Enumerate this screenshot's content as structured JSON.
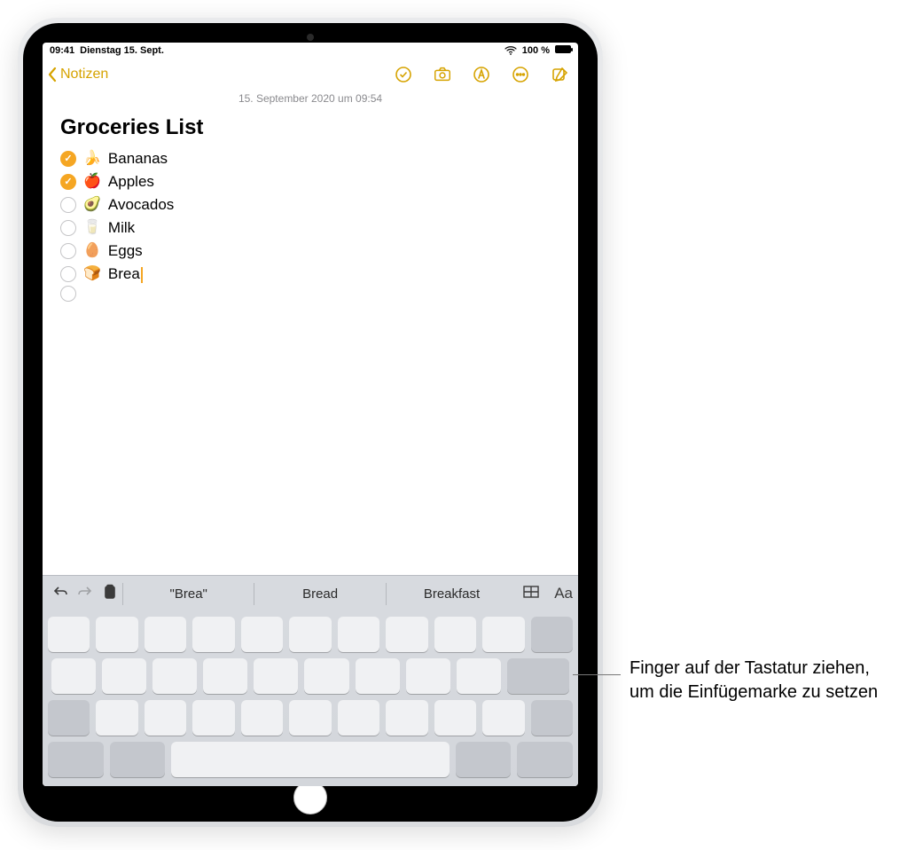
{
  "statusbar": {
    "time": "09:41",
    "date": "Dienstag 15. Sept.",
    "battery_pct": "100 %"
  },
  "navbar": {
    "back_label": "Notizen"
  },
  "note": {
    "date_header": "15. September 2020 um 09:54",
    "title": "Groceries List",
    "items": [
      {
        "checked": true,
        "emoji": "🍌",
        "text": "Bananas"
      },
      {
        "checked": true,
        "emoji": "🍎",
        "text": "Apples"
      },
      {
        "checked": false,
        "emoji": "🥑",
        "text": "Avocados"
      },
      {
        "checked": false,
        "emoji": "🥛",
        "text": "Milk"
      },
      {
        "checked": false,
        "emoji": "🥚",
        "text": "Eggs"
      },
      {
        "checked": false,
        "emoji": "🍞",
        "text": "Brea",
        "caret": true
      },
      {
        "checked": false,
        "emoji": "",
        "text": ""
      }
    ]
  },
  "suggestions": {
    "s1": "\"Brea\"",
    "s2": "Bread",
    "s3": "Breakfast",
    "aa": "Aa"
  },
  "callout": {
    "text": "Finger auf der Tastatur ziehen, um die Einfügemarke zu setzen"
  }
}
